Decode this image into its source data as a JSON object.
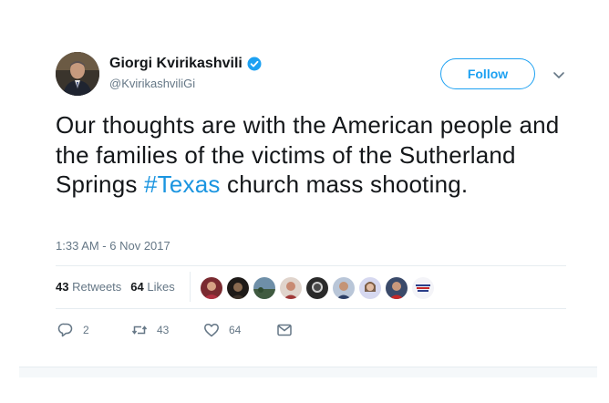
{
  "author": {
    "display_name": "Giorgi Kvirikashvili",
    "handle": "@KvirikashviliGi",
    "verified": true,
    "avatar_icon": "portrait-avatar"
  },
  "follow_label": "Follow",
  "tweet": {
    "text_before": "Our thoughts are with the American people and the families of the victims of the Sutherland Springs ",
    "hashtag": "#Texas",
    "text_after": " church mass shooting.",
    "timestamp": "1:33 AM - 6 Nov 2017"
  },
  "stats": {
    "retweets_count": "43",
    "retweets_label": "Retweets",
    "likes_count": "64",
    "likes_label": "Likes"
  },
  "likers_count_shown": 9,
  "actions": {
    "reply_count": "2",
    "retweet_count": "43",
    "like_count": "64"
  },
  "colors": {
    "accent": "#1da1f2",
    "hashtag": "#1b95e0",
    "muted": "#657786",
    "text": "#14171a"
  }
}
